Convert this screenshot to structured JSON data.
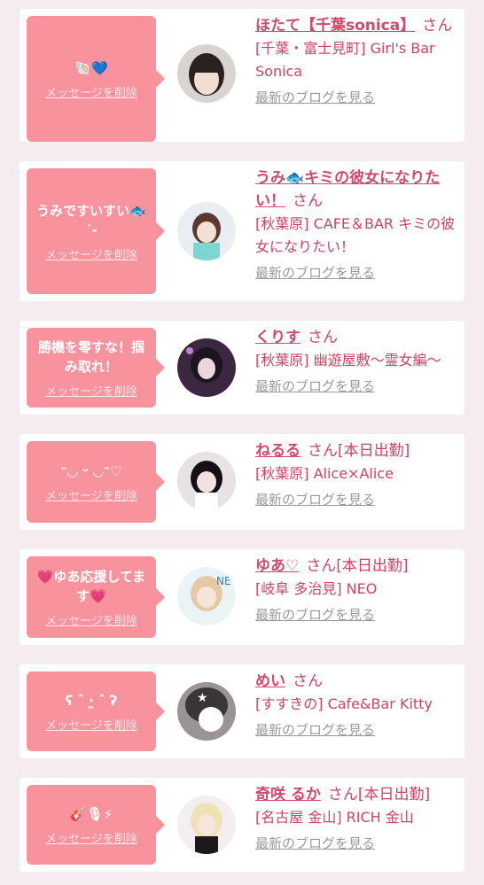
{
  "delete_label": "メッセージを削除",
  "blog_label": "最新のブログを見る",
  "san_label": "さん",
  "colors": {
    "accent": "#f8929d",
    "name": "#d14a6b",
    "page_bg": "#f4ecee"
  },
  "cards": [
    {
      "message": "🐚💙",
      "name": "ほたて【千葉sonica】",
      "tag": "",
      "shop": "[千葉・富士見町] Girl's Bar Sonica"
    },
    {
      "message": "うみですいすい🐟\n´-",
      "name": "うみ🐟キミの彼女になりたい！",
      "tag": "",
      "shop": "[秋葉原] CAFE＆BAR キミの彼女になりたい！"
    },
    {
      "message": "勝機を零すな！掴み取れ！",
      "name": "くりす",
      "tag": "",
      "shop": "[秋葉原] 幽遊屋敷〜霊女編〜"
    },
    {
      "message": "ᵔ◡ ᵕ ◡ᵔ♡",
      "name": "ねるる",
      "tag": "[本日出勤]",
      "shop": "[秋葉原] Alice×Alice"
    },
    {
      "message": "💗ゆあ応援してます💗",
      "name": "ゆあ♡",
      "tag": "[本日出勤]",
      "shop": "[岐阜 多治見] NEO"
    },
    {
      "message": "ʕ ˆ ·̫ ˆ ʔ",
      "name": "めい",
      "tag": "",
      "shop": "[すすきの] Cafe&Bar Kitty"
    },
    {
      "message": "🎸🎙⚡",
      "name": "奇咲 るか",
      "tag": "[本日出勤]",
      "shop": "[名古屋 金山] RICH 金山"
    }
  ]
}
